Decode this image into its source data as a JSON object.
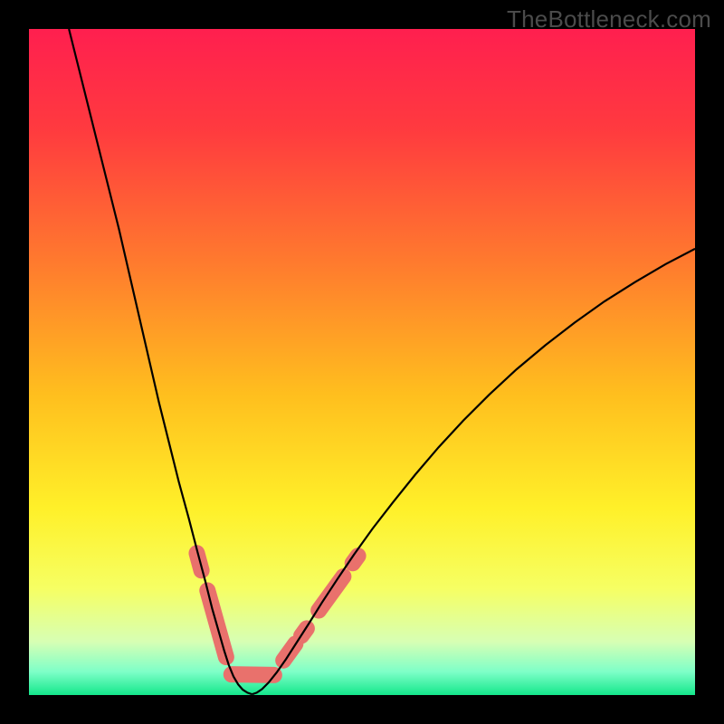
{
  "watermark": "TheBottleneck.com",
  "chart_data": {
    "type": "line",
    "title": "",
    "xlabel": "",
    "ylabel": "",
    "xlim": [
      0,
      100
    ],
    "ylim": [
      0,
      100
    ],
    "grid": false,
    "legend": false,
    "background_gradient_stops": [
      {
        "pos": 0.0,
        "color": "#ff1f4f"
      },
      {
        "pos": 0.15,
        "color": "#ff3a3f"
      },
      {
        "pos": 0.35,
        "color": "#ff7a2e"
      },
      {
        "pos": 0.55,
        "color": "#ffbf1e"
      },
      {
        "pos": 0.72,
        "color": "#fff029"
      },
      {
        "pos": 0.84,
        "color": "#f6ff63"
      },
      {
        "pos": 0.92,
        "color": "#d7ffb4"
      },
      {
        "pos": 0.965,
        "color": "#7effc8"
      },
      {
        "pos": 1.0,
        "color": "#14e78b"
      }
    ],
    "series": [
      {
        "name": "left-curve",
        "stroke": "#000000",
        "stroke_width": 2.2,
        "points_xy": [
          [
            6,
            100
          ],
          [
            7.5,
            94
          ],
          [
            9,
            88
          ],
          [
            10.5,
            82
          ],
          [
            12,
            76
          ],
          [
            13.5,
            70
          ],
          [
            15,
            63.5
          ],
          [
            16.5,
            57
          ],
          [
            18,
            50.5
          ],
          [
            19.5,
            44
          ],
          [
            21,
            38
          ],
          [
            22.5,
            32
          ],
          [
            24,
            26.5
          ],
          [
            25.3,
            21.5
          ],
          [
            26.5,
            17
          ],
          [
            27.5,
            13
          ],
          [
            28.5,
            9.5
          ],
          [
            29.3,
            6.7
          ],
          [
            30,
            4.5
          ],
          [
            30.7,
            2.8
          ],
          [
            31.4,
            1.6
          ],
          [
            32.1,
            0.8
          ],
          [
            32.8,
            0.35
          ],
          [
            33.5,
            0.12
          ]
        ]
      },
      {
        "name": "right-curve",
        "stroke": "#000000",
        "stroke_width": 2.2,
        "points_xy": [
          [
            33.5,
            0.12
          ],
          [
            34.2,
            0.35
          ],
          [
            35,
            0.9
          ],
          [
            36,
            1.9
          ],
          [
            37.2,
            3.4
          ],
          [
            38.6,
            5.4
          ],
          [
            40.2,
            7.9
          ],
          [
            42,
            10.7
          ],
          [
            44,
            13.9
          ],
          [
            46.3,
            17.4
          ],
          [
            48.8,
            21.1
          ],
          [
            51.6,
            25
          ],
          [
            54.7,
            29
          ],
          [
            58,
            33.1
          ],
          [
            61.5,
            37.2
          ],
          [
            65.2,
            41.2
          ],
          [
            69.1,
            45.1
          ],
          [
            73.2,
            48.9
          ],
          [
            77.5,
            52.5
          ],
          [
            81.9,
            55.9
          ],
          [
            86.4,
            59.1
          ],
          [
            91,
            62
          ],
          [
            95.6,
            64.7
          ],
          [
            100,
            67
          ]
        ]
      },
      {
        "name": "thick-pink-overlay",
        "stroke": "#e9716c",
        "stroke_width": 18,
        "linecap": "round",
        "segments_xy": [
          [
            [
              25.2,
              21.3
            ],
            [
              25.9,
              18.7
            ]
          ],
          [
            [
              26.8,
              15.7
            ],
            [
              29.6,
              5.7
            ]
          ],
          [
            [
              30.4,
              3.1
            ],
            [
              36.8,
              3.0
            ]
          ],
          [
            [
              38.2,
              5.2
            ],
            [
              40.0,
              7.7
            ]
          ],
          [
            [
              40.9,
              8.9
            ],
            [
              41.7,
              10.0
            ]
          ],
          [
            [
              43.5,
              12.7
            ],
            [
              47.2,
              17.8
            ]
          ],
          [
            [
              48.6,
              19.8
            ],
            [
              49.4,
              20.9
            ]
          ]
        ]
      }
    ],
    "notes": "V-shaped bottleneck curve. Two black curves descend from top-left and upper-right toward a minimum near x≈33.5, y≈0. Pink rounded segments highlight portions of both curves near the trough. Background is a vertical red→orange→yellow→green gradient. Values are visual estimates; no axes or tick labels are shown."
  }
}
